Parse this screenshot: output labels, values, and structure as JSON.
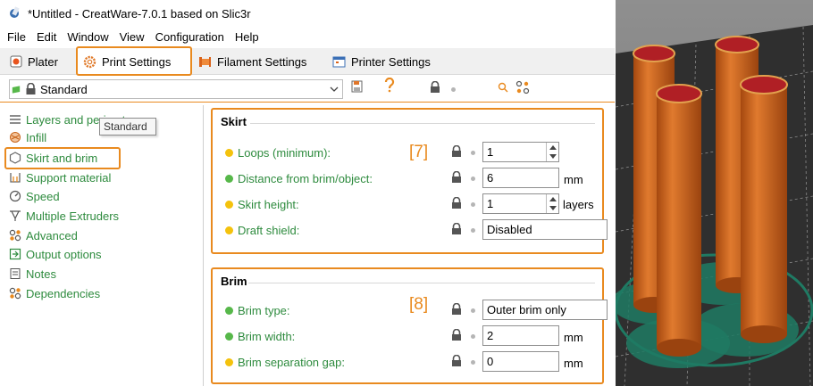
{
  "window": {
    "title": "*Untitled - CreatWare-7.0.1 based on Slic3r"
  },
  "menu": [
    "File",
    "Edit",
    "Window",
    "View",
    "Configuration",
    "Help"
  ],
  "tabs": [
    {
      "label": "Plater",
      "icon": "plater-icon"
    },
    {
      "label": "Print Settings",
      "icon": "gear-icon"
    },
    {
      "label": "Filament Settings",
      "icon": "filament-icon"
    },
    {
      "label": "Printer Settings",
      "icon": "printer-icon"
    }
  ],
  "preset": {
    "selected": "Standard",
    "tooltip": "Standard"
  },
  "sidebar": {
    "items": [
      {
        "label": "Layers and perimeters",
        "icon": "layers-icon"
      },
      {
        "label": "Infill",
        "icon": "infill-icon"
      },
      {
        "label": "Skirt and brim",
        "icon": "skirt-icon"
      },
      {
        "label": "Support material",
        "icon": "support-icon"
      },
      {
        "label": "Speed",
        "icon": "speed-icon"
      },
      {
        "label": "Multiple Extruders",
        "icon": "extruder-icon"
      },
      {
        "label": "Advanced",
        "icon": "advanced-icon"
      },
      {
        "label": "Output options",
        "icon": "output-icon"
      },
      {
        "label": "Notes",
        "icon": "notes-icon"
      },
      {
        "label": "Dependencies",
        "icon": "dependencies-icon"
      }
    ]
  },
  "skirt": {
    "title": "Skirt",
    "annotation": "[7]",
    "loops_label": "Loops (minimum):",
    "loops_value": "1",
    "distance_label": "Distance from brim/object:",
    "distance_value": "6",
    "distance_unit": "mm",
    "height_label": "Skirt height:",
    "height_value": "1",
    "height_unit": "layers",
    "draft_label": "Draft shield:",
    "draft_value": "Disabled"
  },
  "brim": {
    "title": "Brim",
    "annotation": "[8]",
    "type_label": "Brim type:",
    "type_value": "Outer brim only",
    "width_label": "Brim width:",
    "width_value": "2",
    "width_unit": "mm",
    "gap_label": "Brim separation gap:",
    "gap_value": "0",
    "gap_unit": "mm"
  },
  "colors": {
    "accent_orange": "#e98a1f",
    "label_green": "#2e8b3e",
    "system_dot": "#f4c20d",
    "modified_dot": "#57b84a",
    "cylinder": "#c8641a",
    "cylinder_top": "#b01f25",
    "brim": "#1f7a63",
    "bed": "#2f2f2f"
  }
}
